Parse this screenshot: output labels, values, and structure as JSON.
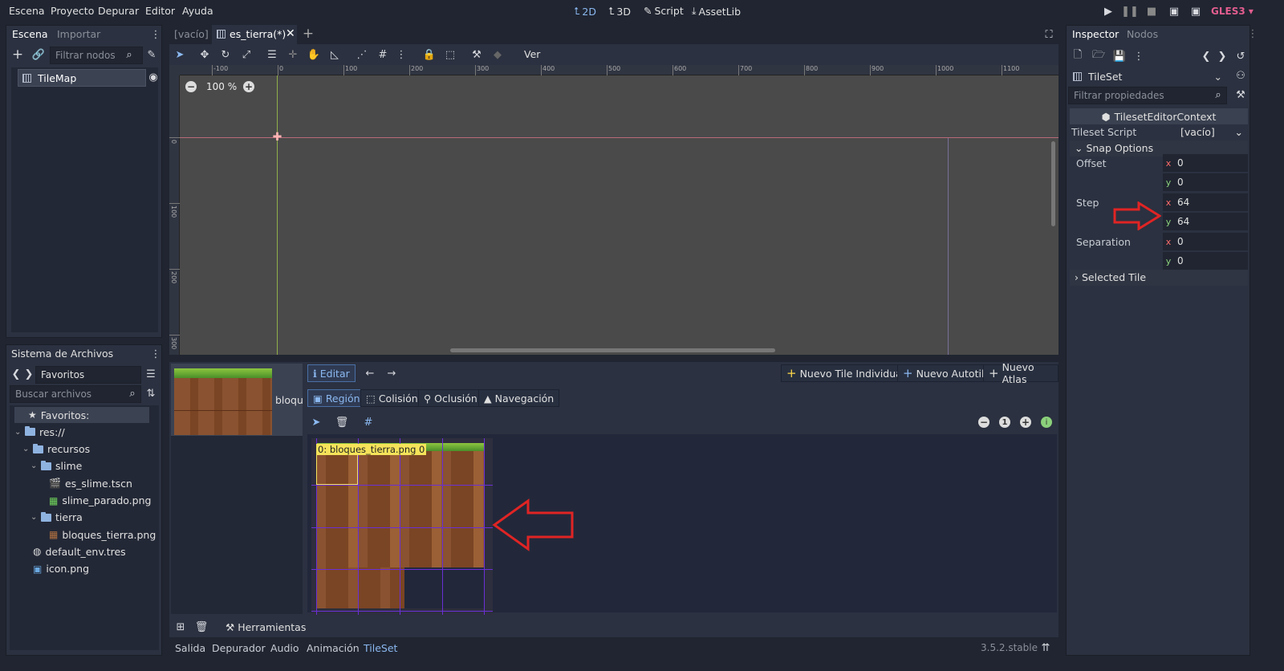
{
  "menu": [
    "Escena",
    "Proyecto",
    "Depurar",
    "Editor",
    "Ayuda"
  ],
  "workspaces": [
    {
      "label": "2D",
      "active": true
    },
    {
      "label": "3D",
      "active": false
    },
    {
      "label": "Script",
      "active": false
    },
    {
      "label": "AssetLib",
      "active": false
    }
  ],
  "renderer": "GLES3",
  "scene_dock": {
    "tabs": [
      "Escena",
      "Importar"
    ],
    "filter_placeholder": "Filtrar nodos",
    "root_node": "TileMap"
  },
  "filesystem": {
    "title": "Sistema de Archivos",
    "path": "Favoritos",
    "search_placeholder": "Buscar archivos",
    "tree": [
      {
        "label": "Favoritos:",
        "indent": 0,
        "kind": "star"
      },
      {
        "label": "res://",
        "indent": 0,
        "kind": "folder"
      },
      {
        "label": "recursos",
        "indent": 1,
        "kind": "folder"
      },
      {
        "label": "slime",
        "indent": 2,
        "kind": "folder"
      },
      {
        "label": "es_slime.tscn",
        "indent": 3,
        "kind": "scene"
      },
      {
        "label": "slime_parado.png",
        "indent": 3,
        "kind": "image"
      },
      {
        "label": "tierra",
        "indent": 2,
        "kind": "folder"
      },
      {
        "label": "bloques_tierra.png",
        "indent": 3,
        "kind": "image"
      },
      {
        "label": "default_env.tres",
        "indent": 1,
        "kind": "env"
      },
      {
        "label": "icon.png",
        "indent": 1,
        "kind": "icon"
      }
    ]
  },
  "editor_tabs": [
    {
      "label": "[vacío]",
      "active": false
    },
    {
      "label": "es_tierra(*)",
      "active": true
    }
  ],
  "toolbar": {
    "view_label": "Ver"
  },
  "viewport": {
    "zoom": "100 %",
    "ruler_top": [
      "-100",
      "0",
      "100",
      "200",
      "300",
      "400",
      "500",
      "600",
      "700",
      "800",
      "900",
      "1000",
      "1100"
    ],
    "ruler_left": [
      "0",
      "100",
      "200",
      "300"
    ]
  },
  "tileset_editor": {
    "texture_label": "bloques_tierra.png",
    "edit_label": "Editar",
    "new_single": "Nuevo Tile Individual",
    "new_autotile": "Nuevo Autotile",
    "new_atlas": "Nuevo Atlas",
    "modes": [
      "Región",
      "Colisión",
      "Oclusión",
      "Navegación"
    ],
    "tile_tag": "0: bloques_tierra.png 0",
    "tools_label": "Herramientas"
  },
  "bottom_tabs": [
    "Salida",
    "Depurador",
    "Audio",
    "Animación",
    "TileSet"
  ],
  "version": "3.5.2.stable",
  "inspector": {
    "tabs": [
      "Inspector",
      "Nodos"
    ],
    "resource": "TileSet",
    "filter_placeholder": "Filtrar propiedades",
    "context": "TilesetEditorContext",
    "script_label": "Tileset Script",
    "script_value": "[vacío]",
    "snap_section": "Snap Options",
    "offset_label": "Offset",
    "offset": {
      "x": "0",
      "y": "0"
    },
    "step_label": "Step",
    "step": {
      "x": "64",
      "y": "64"
    },
    "separation_label": "Separation",
    "separation": {
      "x": "0",
      "y": "0"
    },
    "selected_tile": "Selected Tile"
  },
  "colors": {
    "accent": "#8bb8f0",
    "renderer": "#e35d8f",
    "annotation": "#e02424",
    "tag": "#f5e35a",
    "grid": "#6a2fd6"
  }
}
